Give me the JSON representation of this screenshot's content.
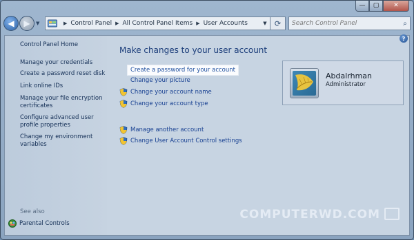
{
  "window": {
    "caption_buttons": [
      "—",
      "▢",
      "✕"
    ]
  },
  "address_bar": {
    "crumbs": [
      "Control Panel",
      "All Control Panel Items",
      "User Accounts"
    ],
    "search_placeholder": "Search Control Panel"
  },
  "left_pane": {
    "home": "Control Panel Home",
    "links": [
      "Manage your credentials",
      "Create a password reset disk",
      "Link online IDs",
      "Manage your file encryption certificates",
      "Configure advanced user profile properties",
      "Change my environment variables"
    ],
    "see_also": "See also",
    "parental_controls": "Parental Controls"
  },
  "main": {
    "heading": "Make changes to your user account",
    "tasks": [
      "Create a password for your account",
      "Change your picture",
      "Change your account name",
      "Change your account type"
    ],
    "other_tasks": [
      "Manage another account",
      "Change User Account Control settings"
    ]
  },
  "user": {
    "name": "Abdalrhman",
    "role": "Administrator"
  },
  "watermark": "COMPUTERWD.COM",
  "colors": {
    "link": "#163f91",
    "heading": "#1b3d7a",
    "highlight_bg": "#fbfcfe"
  }
}
